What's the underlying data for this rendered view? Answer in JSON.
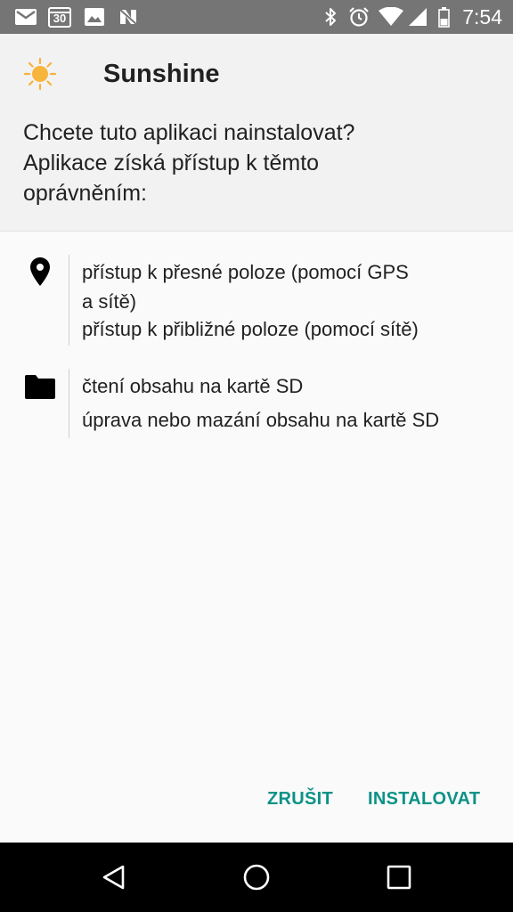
{
  "status_bar": {
    "time": "7:54",
    "calendar_day": "30",
    "icons": [
      "gmail-icon",
      "calendar-icon",
      "photos-icon",
      "n-icon",
      "bluetooth-icon",
      "alarm-icon",
      "wifi-icon",
      "signal-icon",
      "battery-icon"
    ]
  },
  "app": {
    "name": "Sunshine",
    "icon": "sun-icon"
  },
  "dialog": {
    "question_lines": [
      "Chcete tuto aplikaci nainstalovat?",
      "Aplikace získá přístup k těmto",
      "oprávněním:"
    ]
  },
  "permissions": [
    {
      "icon": "location-pin-icon",
      "items": [
        [
          "přístup k přesné poloze (pomocí GPS",
          "a sítě)"
        ],
        [
          "přístup k přibližné poloze (pomocí sítě)"
        ]
      ]
    },
    {
      "icon": "folder-icon",
      "items": [
        [
          "čtení obsahu na kartě SD"
        ],
        [
          "úprava nebo mazání obsahu na kartě SD"
        ]
      ]
    }
  ],
  "actions": {
    "cancel_label": "ZRUŠIT",
    "install_label": "INSTALOVAT",
    "accent_color": "#0b9287"
  },
  "nav_bar": {
    "buttons": [
      "back-icon",
      "home-icon",
      "recents-icon"
    ]
  }
}
